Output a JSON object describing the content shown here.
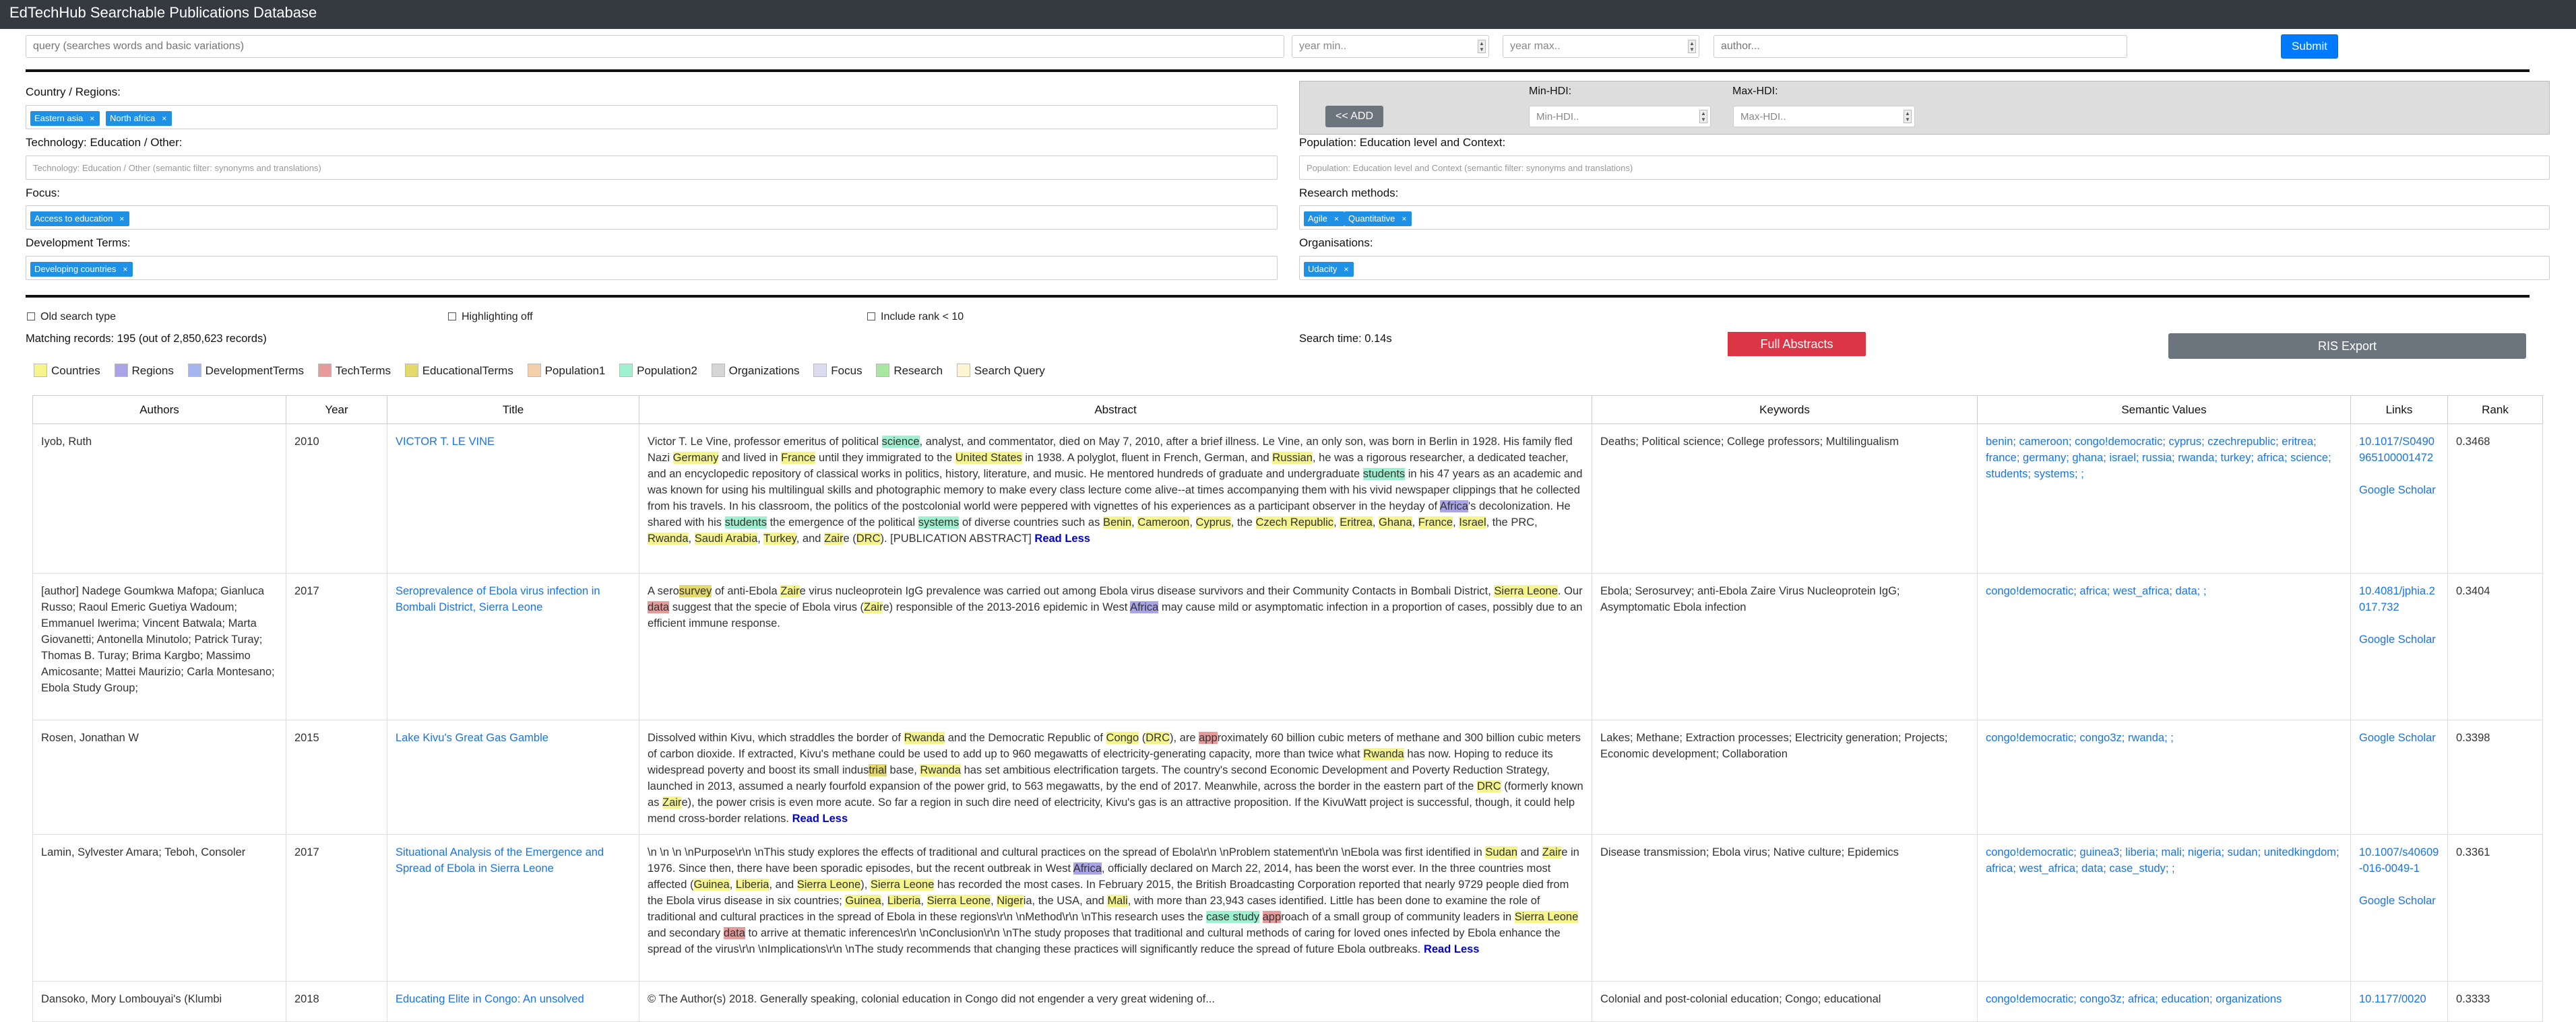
{
  "app": {
    "title": "EdTechHub Searchable Publications Database"
  },
  "search": {
    "query_placeholder": "query (searches words and basic variations)",
    "year_min_placeholder": "year min..",
    "year_max_placeholder": "year max..",
    "author_placeholder": "author...",
    "submit_label": "Submit"
  },
  "filters": {
    "country_label": "Country / Regions:",
    "country_tags": [
      "Eastern asia",
      "North africa"
    ],
    "add_label": "<< ADD",
    "min_hdi_label": "Min-HDI:",
    "max_hdi_label": "Max-HDI:",
    "min_hdi_placeholder": "Min-HDI..",
    "max_hdi_placeholder": "Max-HDI..",
    "technology_label": "Technology: Education / Other:",
    "technology_placeholder": "Technology: Education / Other (semantic filter: synonyms and translations)",
    "population_label": "Population: Education level and Context:",
    "population_placeholder": "Population: Education level and Context (semantic filter: synonyms and translations)",
    "focus_label": "Focus:",
    "focus_tags": [
      "Access to education"
    ],
    "research_label": "Research methods:",
    "research_tags": [
      "Agile",
      "Quantitative"
    ],
    "devterms_label": "Development Terms:",
    "devterms_tags": [
      "Developing countries"
    ],
    "org_label": "Organisations:",
    "org_tags": [
      "Udacity"
    ]
  },
  "options": {
    "old_search": "Old search type",
    "highlighting": "Highlighting off",
    "include_rank": "Include rank < 10",
    "matching_records": "Matching records: 195 (out of 2,850,623 records)",
    "search_time": "Search time: 0.14s",
    "full_abstracts_label": "Full Abstracts",
    "ris_label": "RIS Export"
  },
  "legend": [
    {
      "label": "Countries",
      "color": "#f6f58c"
    },
    {
      "label": "Regions",
      "color": "#a9a3e8"
    },
    {
      "label": "DevelopmentTerms",
      "color": "#a6b5ef"
    },
    {
      "label": "TechTerms",
      "color": "#e79a9a"
    },
    {
      "label": "EducationalTerms",
      "color": "#e5d96a"
    },
    {
      "label": "Population1",
      "color": "#f5cfaa"
    },
    {
      "label": "Population2",
      "color": "#9df0d0"
    },
    {
      "label": "Organizations",
      "color": "#d6d6d6"
    },
    {
      "label": "Focus",
      "color": "#dcdcf0"
    },
    {
      "label": "Research",
      "color": "#a8e7a0"
    },
    {
      "label": "Search Query",
      "color": "#fff5d0"
    }
  ],
  "table": {
    "headers": [
      "Authors",
      "Year",
      "Title",
      "Abstract",
      "Keywords",
      "Semantic Values",
      "Links",
      "Rank"
    ],
    "rows": [
      {
        "authors": "Iyob, Ruth",
        "year": "2010",
        "title": "VICTOR T. LE VINE",
        "keywords": "Deaths; Political science; College professors; Multilingualism",
        "semantic": "benin; cameroon; congo!democratic; cyprus; czechrepublic; eritrea; france; germany; ghana; israel; russia; rwanda; turkey; africa; science; students; systems; ;",
        "links": [
          "10.1017/S0490965100001472",
          "Google Scholar"
        ],
        "rank": "0.3468"
      },
      {
        "authors": "[author] Nadege Goumkwa Mafopa; Gianluca Russo; Raoul Emeric Guetiya Wadoum; Emmanuel Iwerima; Vincent Batwala; Marta Giovanetti; Antonella Minutolo; Patrick Turay; Thomas B. Turay; Brima Kargbo; Massimo Amicosante; Mattei Maurizio; Carla Montesano; Ebola Study Group;",
        "year": "2017",
        "title": "Seroprevalence of Ebola virus infection in Bombali District, Sierra Leone",
        "keywords": "Ebola; Serosurvey; anti-Ebola Zaire Virus Nucleoprotein IgG; Asymptomatic Ebola infection",
        "semantic": "congo!democratic; africa; west_africa; data; ;",
        "links": [
          "10.4081/jphia.2017.732",
          "Google Scholar"
        ],
        "rank": "0.3404"
      },
      {
        "authors": "Rosen, Jonathan W",
        "year": "2015",
        "title": "Lake Kivu's Great Gas Gamble",
        "keywords": "Lakes; Methane; Extraction processes; Electricity generation; Projects; Economic development; Collaboration",
        "semantic": "congo!democratic; congo3z; rwanda; ;",
        "links": [
          "Google Scholar"
        ],
        "rank": "0.3398"
      },
      {
        "authors": "Lamin, Sylvester Amara; Teboh, Consoler",
        "year": "2017",
        "title": "Situational Analysis of the Emergence and Spread of Ebola in Sierra Leone",
        "keywords": "Disease transmission; Ebola virus; Native culture; Epidemics",
        "semantic": "congo!democratic; guinea3; liberia; mali; nigeria; sudan; unitedkingdom; africa; west_africa; data; case_study; ;",
        "links": [
          "10.1007/s40609-016-0049-1",
          "Google Scholar"
        ],
        "rank": "0.3361"
      },
      {
        "authors": "Dansoko, Mory Lombouyai's (Klumbi",
        "year": "2018",
        "title": "Educating Elite in Congo: An unsolved",
        "keywords": "Colonial and post-colonial education; Congo; educational",
        "semantic": "congo!democratic; congo3z; africa; education; organizations",
        "links": [
          "10.1177/0020"
        ],
        "rank": "0.3333"
      }
    ],
    "read_less": "Read Less"
  }
}
